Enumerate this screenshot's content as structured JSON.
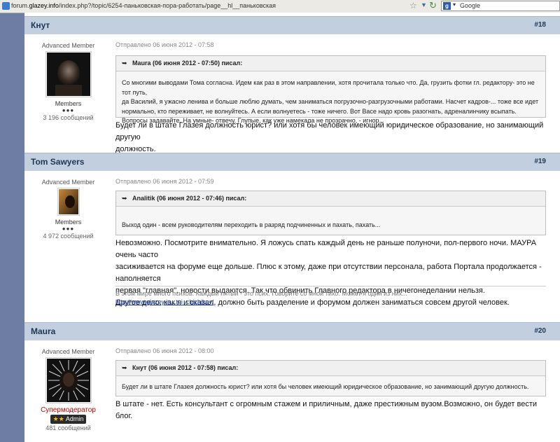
{
  "browser": {
    "url_prefix": "forum.",
    "url_domain": "glazey.info",
    "url_rest": "/index.php?/topic/6254-паньковская-пора-работать/page__hl__паньковская",
    "search_engine": "Google"
  },
  "posts": [
    {
      "author": "Кнут",
      "number": "#18",
      "rank": "Advanced Member",
      "group": "Members",
      "pips": "●●●",
      "post_count": "3 196 сообщений",
      "date": "Отправлено 06 июня 2012 - 07:58",
      "quote_title": "Maura (06 июня 2012 - 07:50) писал:",
      "quote_lines": [
        "Со многими выводами Тома согласна. Идем как раз в этом направлении, хотя прочитала только что. Да, грузить фотки гл. редактору- это не тот путь,",
        "да Василий, я ужасно ленива и больше люблю думать, чем заниматься погрузочно-разгрузочными работами. Насчет кадров-... тоже все идет",
        "нормально, кто переживает, не волнуйтесь. А если волнуетесь - тоже ничего. Вот Васе надо кровь разогнать, адреналинчику всыпать.",
        "Вопросы задавайте. На умные- отвечу. Глупые, как уже намекала не прозрачно, - игнор."
      ],
      "text_lines": [
        "Будет ли в штате Глазея должность юрист? или хотя бы человек имеющий юридическое образование, но занимающий другую",
        "должность."
      ]
    },
    {
      "author": "Tom Sawyers",
      "number": "#19",
      "rank": "Advanced Member",
      "group": "Members",
      "pips": "●●●",
      "post_count": "4 972 сообщений",
      "date": "Отправлено 06 июня 2012 - 07:59",
      "quote_title": "Analitik (06 июня 2012 - 07:46) писал:",
      "quote_lines": [
        "Выход один - всем руководителям переходить в разряд подчиненных и пахать, пахать..."
      ],
      "text_lines": [
        "Невозможно. Посмотрите внимательно. Я ложусь спать каждый день не раньше полуночи, пол-первого ночи. МАУРА очень часто",
        "засиживается на форуме еще дольше. Плюс к этому, даже при отсутствии персонала, работа Портала продолжается - наполняется",
        "первая \"главная\", новости выдаются. Так что обвинить Главного редактора в ничегонеделании нельзя.",
        "Другое дело, как я и сказал, должно быть разделение и форумом должен заниматься совсем другой человек."
      ],
      "signature": "В этом мире много психов. Каждый пятый - это псих. Говорите со мной тихо. Может я один из них...",
      "signature_link": "http://www.glazey.in...tni_chizhikov/"
    },
    {
      "author": "Maura",
      "number": "#20",
      "rank": "Advanced Member",
      "group": "Супермодератор",
      "badge_stars": "★★",
      "badge_label": "Admin",
      "post_count": "481 сообщений",
      "date": "Отправлено 06 июня 2012 - 08:00",
      "quote_title": "Кнут (06 июня 2012 - 07:58) писал:",
      "quote_lines": [
        "Будет ли в штате Глазея должность юрист? или хотя бы человек имеющий юридическое образование, но занимающий другую должность."
      ],
      "text_lines": [
        "В штате - нет. Есть консультант с огромным стажем и приличным, даже престижным вузом.Возможно, он будет вести блог."
      ]
    }
  ]
}
